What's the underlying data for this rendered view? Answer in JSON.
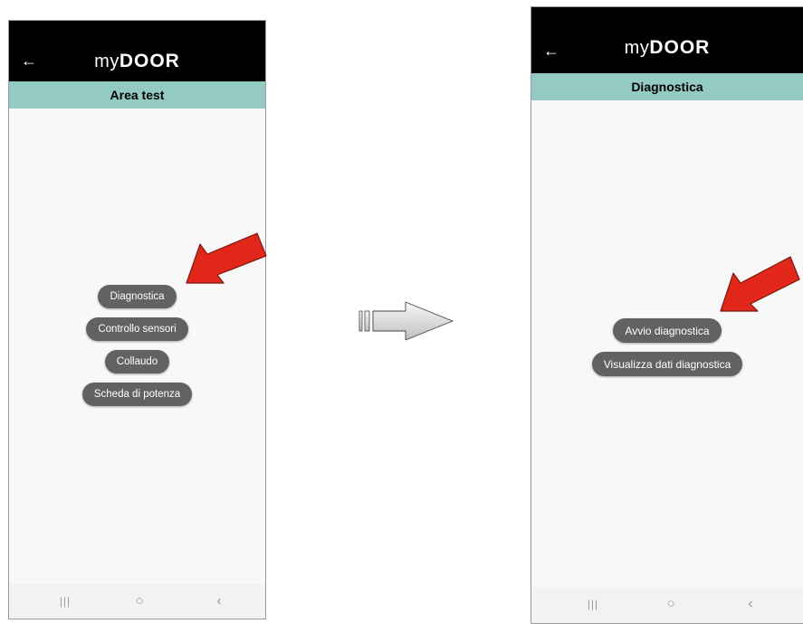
{
  "left_screen": {
    "logo": {
      "prefix": "my",
      "brand": "DOOR"
    },
    "back_glyph": "←",
    "section_title": "Area test",
    "buttons": [
      {
        "label": "Diagnostica"
      },
      {
        "label": "Controllo sensori"
      },
      {
        "label": "Collaudo"
      },
      {
        "label": "Scheda di potenza"
      }
    ]
  },
  "right_screen": {
    "logo": {
      "prefix": "my",
      "brand": "DOOR"
    },
    "back_glyph": "←",
    "section_title": "Diagnostica",
    "buttons": [
      {
        "label": "Avvio diagnostica"
      },
      {
        "label": "Visualizza dati diagnostica"
      }
    ]
  },
  "nav_glyphs": {
    "recents": "|||",
    "home": "○",
    "back": "‹"
  },
  "colors": {
    "app_bar": "#000000",
    "section_bar": "#93cbc3",
    "button": "#626262",
    "screen_bg": "#f8f8f8",
    "pointer_arrow": "#e2261a",
    "transition_arrow": "#d9d9d9"
  },
  "icons": {
    "back": "arrow-left-icon",
    "pointer": "red-pointer-arrow-icon",
    "transition": "transition-arrow-icon",
    "nav_recents": "recents-icon",
    "nav_home": "home-icon",
    "nav_back": "nav-back-icon"
  }
}
